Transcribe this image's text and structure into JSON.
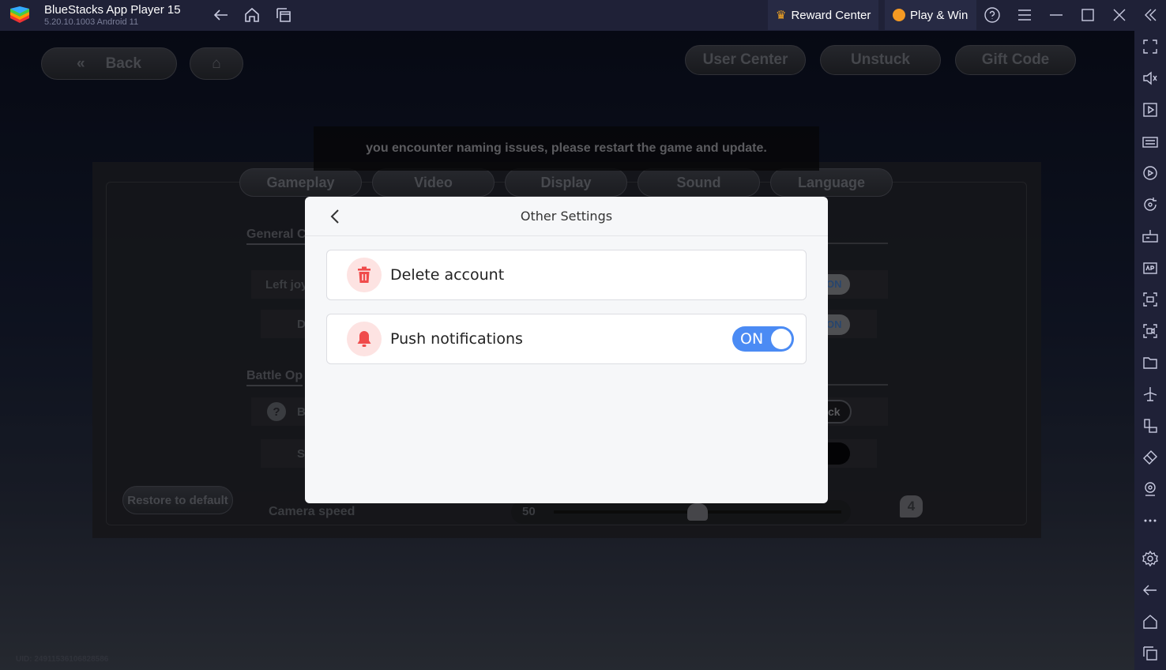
{
  "titlebar": {
    "title": "BlueStacks App Player 15",
    "version": "5.20.10.1003  Android 11",
    "reward_center": "Reward Center",
    "play_win": "Play & Win"
  },
  "game": {
    "back_label": "Back",
    "top_buttons": [
      "User Center",
      "Unstuck",
      "Gift Code"
    ],
    "notice": "you encounter naming issues, please restart the game and update.",
    "tabs": [
      "Gameplay",
      "Video",
      "Display",
      "Sound",
      "Language"
    ],
    "sections": [
      "General C",
      "Battle Op"
    ],
    "rows": [
      "Left joy",
      "D",
      "B",
      "S"
    ],
    "toggle_on": "ON",
    "mode_label": "ck",
    "restore_label": "Restore to default",
    "camera_label": "Camera speed",
    "camera_value": "50",
    "camera_fraction": 0.5,
    "badge": "4",
    "uid": "UID: 24911536106828586"
  },
  "modal": {
    "title": "Other Settings",
    "items": [
      {
        "label": "Delete account",
        "icon": "trash-icon"
      },
      {
        "label": "Push notifications",
        "icon": "bell-icon",
        "toggle": "ON",
        "enabled": true
      }
    ]
  },
  "colors": {
    "accent": "#4b8bf4",
    "danger": "#f04b4b",
    "titlebar": "#1f2137"
  }
}
